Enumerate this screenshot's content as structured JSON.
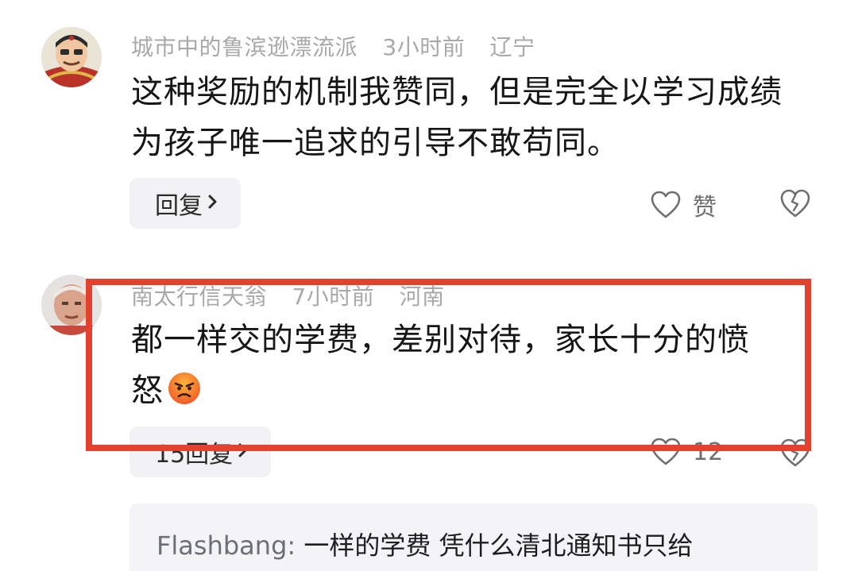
{
  "comments": [
    {
      "author": "城市中的鲁滨逊漂流派",
      "time": "3小时前",
      "location": "辽宁",
      "text": "这种奖励的机制我赞同，但是完全以学习成绩为孩子唯一追求的引导不敢苟同。",
      "reply_label": "回复",
      "like_label": "赞"
    },
    {
      "author": "南太行信天翁",
      "time": "7小时前",
      "location": "河南",
      "text_line1": "都一样交的学费，差别对待，家长十分的愤",
      "text_line2": "怒",
      "emoji": "😡",
      "reply_label": "15回复",
      "like_count": "12"
    }
  ],
  "sub_reply": {
    "author": "Flashbang:",
    "text": " 一样的学费 凭什么清北通知书只给"
  },
  "colors": {
    "highlight_border": "#e2422d",
    "meta_text": "#a9a9ab",
    "pill_bg": "#f2f2f4"
  },
  "icons": [
    "heart-icon",
    "broken-heart-icon",
    "chevron-right-icon",
    "angry-face-emoji"
  ]
}
